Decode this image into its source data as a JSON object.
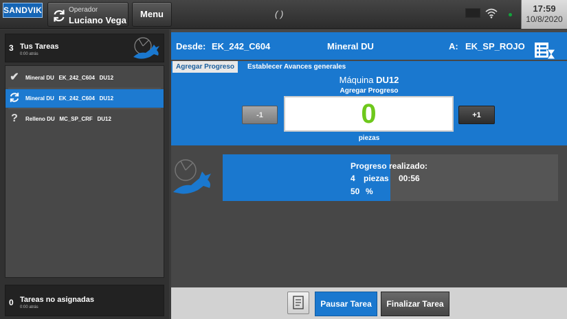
{
  "header": {
    "logo_text": "SANDVIK",
    "operator_label": "Operador",
    "operator_name": "Luciano Vega",
    "menu_label": "Menu",
    "center_text": "( )",
    "time": "17:59",
    "date": "10/8/2020"
  },
  "sidebar": {
    "tasks_count": "3",
    "tasks_title": "Tus Tareas",
    "tasks_subtitle": "0:00 atrás",
    "items": [
      {
        "icon": "check-icon",
        "label": "Mineral DU   EK_242_C604   DU12",
        "active": false
      },
      {
        "icon": "sync-icon",
        "label": "Mineral DU   EK_242_C604   DU12",
        "active": true
      },
      {
        "icon": "question-icon",
        "label": "Relleno DU   MC_SP_CRF   DU12",
        "active": false
      }
    ],
    "unassigned_count": "0",
    "unassigned_title": "Tareas no asignadas",
    "unassigned_subtitle": "0:00 atrás"
  },
  "route": {
    "from_label": "Desde:",
    "from_value": "EK_242_C604",
    "material": "Mineral DU",
    "to_label": "A:",
    "to_value": "EK_SP_ROJO"
  },
  "tabs": [
    {
      "label": "Agregar Progreso",
      "active": true
    },
    {
      "label": "Establecer Avances generales",
      "active": false
    }
  ],
  "progress": {
    "machine_label": "Máquina",
    "machine_value": "DU12",
    "heading": "Agregar Progreso",
    "minus_label": "-1",
    "plus_label": "+1",
    "counter_value": "0",
    "unit": "piezas"
  },
  "summary": {
    "title": "Progreso realizado:",
    "count": "4",
    "count_unit": "piezas",
    "time": "00:56",
    "percent": "50",
    "percent_unit": "%",
    "fill_fraction": 0.5
  },
  "actions": {
    "pause_label": "Pausar Tarea",
    "finish_label": "Finalizar Tarea"
  },
  "colors": {
    "accent": "#1a78cf",
    "counter": "#6ec81c",
    "status_dot": "#12a53c"
  }
}
